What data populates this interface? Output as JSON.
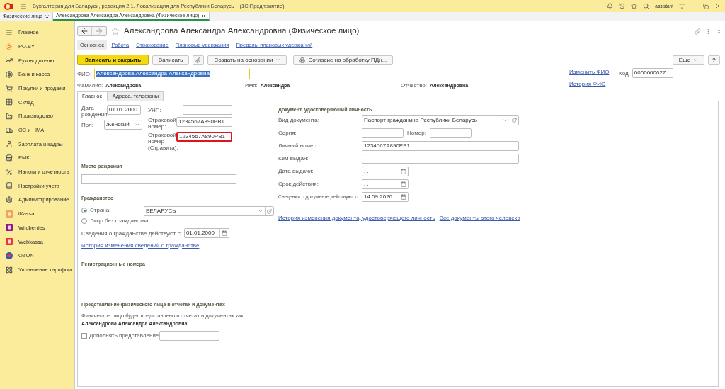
{
  "window": {
    "title": "Бухгалтерия для Беларуси, редакция 2.1. Локализация для Республики Беларусь",
    "app": "(1С:Предприятие)",
    "user": "assistant"
  },
  "tabs": [
    {
      "label": "Физические лица",
      "selected": false
    },
    {
      "label": "Александрова Александра Александровна (Физическое лицо)",
      "selected": true
    }
  ],
  "sidebar": {
    "items": [
      {
        "label": "Главное"
      },
      {
        "label": "PO.BY"
      },
      {
        "label": "Руководителю"
      },
      {
        "label": "Банк и касса"
      },
      {
        "label": "Покупки и продажи"
      },
      {
        "label": "Склад"
      },
      {
        "label": "Производство"
      },
      {
        "label": "ОС и НМА"
      },
      {
        "label": "Зарплата и кадры"
      },
      {
        "label": "РМК"
      },
      {
        "label": "Налоги и отчетность"
      },
      {
        "label": "Настройки учета"
      },
      {
        "label": "Администрирование"
      },
      {
        "label": "iKassa"
      },
      {
        "label": "Wildberries"
      },
      {
        "label": "Webkassa"
      },
      {
        "label": "OZON"
      },
      {
        "label": "Управление тарифом"
      }
    ]
  },
  "form": {
    "title": "Александрова Александра Александровна (Физическое лицо)",
    "sections": [
      {
        "label": "Основное",
        "selected": true
      },
      {
        "label": "Работа",
        "selected": false
      },
      {
        "label": "Страхование",
        "selected": false
      },
      {
        "label": "Плановые удержания",
        "selected": false
      },
      {
        "label": "Пределы плановых удержаний",
        "selected": false
      }
    ],
    "toolbar": {
      "primary": "Записать и закрыть",
      "save": "Записать",
      "create_based": "Создать на основании",
      "consent": "Согласие на обработку ПДн...",
      "more": "Еще",
      "help": "?"
    },
    "fio": {
      "label": "ФИО:",
      "value": "Александрова Александра Александровна",
      "text_selected": true
    },
    "change_fio": "Изменить ФИО",
    "fio_history": "История ФИО",
    "code": {
      "label": "Код:",
      "value": "0000000027"
    },
    "surname": {
      "label": "Фамилия:",
      "value": "Александрова"
    },
    "name": {
      "label": "Имя:",
      "value": "Александра"
    },
    "patronymic": {
      "label": "Отчество:",
      "value": "Александровна"
    },
    "inner_tabs": [
      {
        "label": "Главное",
        "selected": true
      },
      {
        "label": "Адреса, телефоны",
        "selected": false
      }
    ],
    "main": {
      "birth_date": {
        "label": "Дата рождения:",
        "value": "01.01.2000"
      },
      "unp": {
        "label": "УНП:"
      },
      "gender": {
        "label": "Пол:",
        "value": "Женский"
      },
      "insurance": {
        "label": "Страховой номер:",
        "value": "1234567A890PB1"
      },
      "insurance_stravita": {
        "label": "Страховой номер (Стравита):",
        "value": "1234567A890PB1",
        "highlighted": true
      },
      "birth_place": {
        "heading": "Место рождения",
        "button": "..."
      },
      "citizenship": {
        "heading": "Гражданство",
        "options": [
          {
            "label": "Страна",
            "selected": true
          },
          {
            "label": "Лицо без гражданства",
            "selected": false
          }
        ],
        "country": "БЕЛАРУСЬ"
      },
      "citizenship_from": {
        "label": "Сведения о гражданстве действуют с:",
        "value": "01.01.2000"
      },
      "citizenship_history": "История изменения сведений о гражданстве",
      "reg_numbers": "Регистрационные номера",
      "presentation": {
        "heading": "Представление физического лица в отчетах и документах",
        "text": "Физическое лицо будет представлено в отчетах и документах как:",
        "value": "Александрова Александра Александровна",
        "supplement": {
          "label": "Дополнять представление",
          "checked": false
        }
      }
    },
    "document": {
      "heading": "Документ, удостоверяющий личность",
      "type": {
        "label": "Вид документа:",
        "value": "Паспорт гражданина Республики Беларусь"
      },
      "series": {
        "label": "Серия:"
      },
      "number": {
        "label": "Номер:"
      },
      "personal_number": {
        "label": "Личный номер:",
        "value": "1234567A890PB1"
      },
      "issued_by": {
        "label": "Кем выдан:"
      },
      "issue_date": {
        "label": "Дата выдачи:",
        "value": " .  ."
      },
      "valid_until": {
        "label": "Срок действия:",
        "value": " .  ."
      },
      "valid_from": {
        "label": "Сведения о документе действуют с:",
        "value": "14.09.2026"
      },
      "links": [
        "История изменения документа, удостоверяющего личность",
        "Все документы этого человека"
      ]
    }
  }
}
